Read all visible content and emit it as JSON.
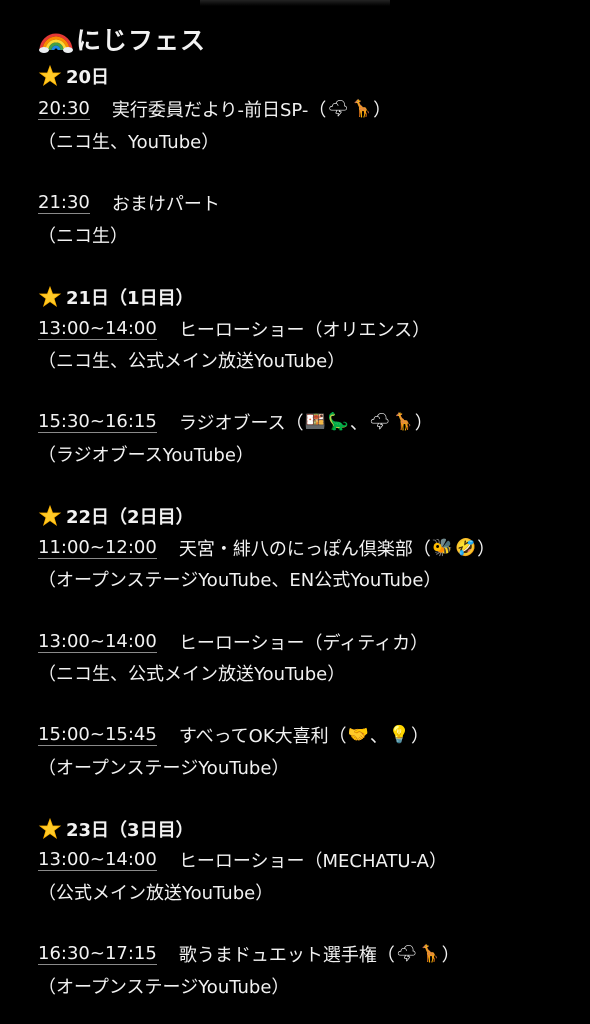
{
  "title": {
    "icon": "rainbow-icon",
    "text": "にじフェス"
  },
  "days": [
    {
      "label": "20日",
      "icon": "glowing-star-icon",
      "events": [
        {
          "time": "20:30",
          "name": "実行委員だより-前日SP-（",
          "emojis": [
            "🌩",
            "🦒"
          ],
          "close": "）",
          "channel": "（ニコ生、YouTube）"
        },
        {
          "time": "21:30",
          "name": "おまけパート",
          "emojis": [],
          "close": "",
          "channel": "（ニコ生）"
        }
      ]
    },
    {
      "label": "21日（1日目）",
      "icon": "glowing-star-icon",
      "events": [
        {
          "time": "13:00~14:00",
          "name": "ヒーローショー（オリエンス）",
          "emojis": [],
          "close": "",
          "channel": "（ニコ生、公式メイン放送YouTube）"
        },
        {
          "time": "15:30~16:15",
          "name": "ラジオブース（",
          "emojis": [
            "🍱",
            "🦕",
            "、",
            "🌩",
            "🦒"
          ],
          "close": "）",
          "channel": "（ラジオブースYouTube）"
        }
      ]
    },
    {
      "label": "22日（2日目）",
      "icon": "glowing-star-icon",
      "events": [
        {
          "time": "11:00~12:00",
          "name": "天宮・緋八のにっぽん倶楽部（",
          "emojis": [
            "🐝",
            "🤣"
          ],
          "close": "）",
          "channel": "（オープンステージYouTube、EN公式YouTube）"
        },
        {
          "time": "13:00~14:00",
          "name": "ヒーローショー（ディティカ）",
          "emojis": [],
          "close": "",
          "channel": "（ニコ生、公式メイン放送YouTube）"
        },
        {
          "time": "15:00~15:45",
          "name": "すべってOK大喜利（",
          "emojis": [
            "🤝",
            "、",
            "💡"
          ],
          "close": "）",
          "channel": "（オープンステージYouTube）"
        }
      ]
    },
    {
      "label": "23日（3日目）",
      "icon": "glowing-star-icon",
      "events": [
        {
          "time": "13:00~14:00",
          "name": "ヒーローショー（MECHATU-A）",
          "emojis": [],
          "close": "",
          "channel": "（公式メイン放送YouTube）"
        },
        {
          "time": "16:30~17:15",
          "name": "歌うまドュエット選手権（",
          "emojis": [
            "🌩",
            "🦒"
          ],
          "close": "）",
          "channel": "（オープンステージYouTube）"
        }
      ]
    }
  ]
}
